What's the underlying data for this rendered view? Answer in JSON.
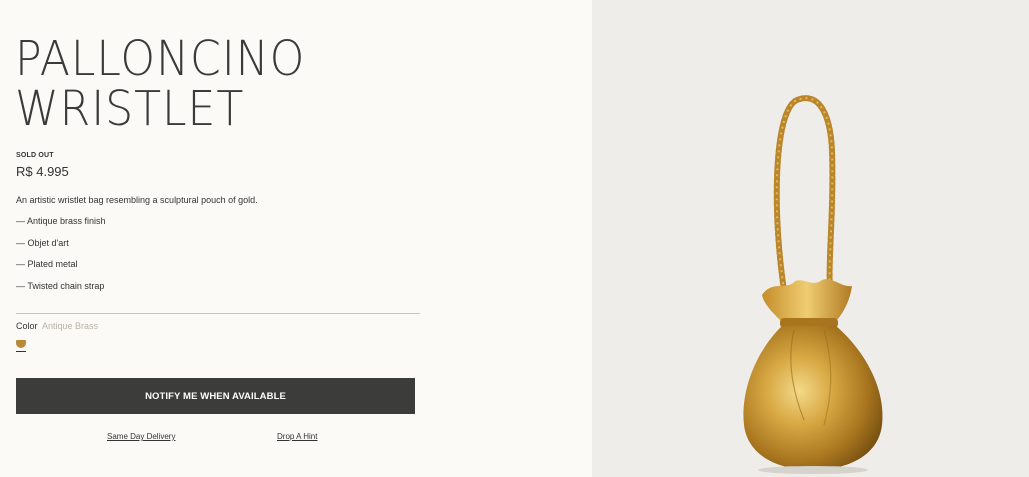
{
  "product": {
    "title_line1": "PALLONCINO",
    "title_line2": "WRISTLET",
    "status": "SOLD OUT",
    "price": "R$ 4.995",
    "description": "An artistic wristlet bag resembling a sculptural pouch of gold.",
    "features": [
      "— Antique brass finish",
      "— Objet d'art",
      "— Plated metal",
      "— Twisted chain strap"
    ]
  },
  "color": {
    "label": "Color",
    "value": "Antique Brass",
    "swatch_color": "#b8893a"
  },
  "actions": {
    "notify_label": "NOTIFY ME WHEN AVAILABLE",
    "delivery_link": "Same Day Delivery",
    "hint_link": "Drop A Hint"
  },
  "image": {
    "subject": "gold-pouch-wristlet-bag"
  }
}
